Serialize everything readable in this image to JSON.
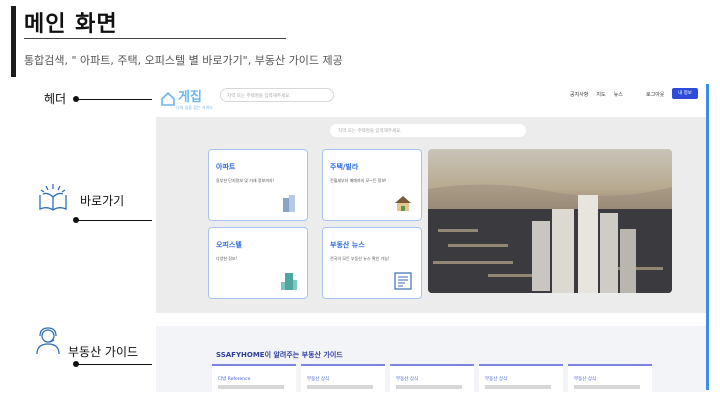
{
  "slide": {
    "title": "메인 화면",
    "subtitle": "통합검색,  \" 아파트, 주택, 오피스텔 별 바로가기\", 부동산 가이드 제공"
  },
  "annotations": {
    "header": "헤더",
    "shortcut": "바로가기",
    "guide": "부동산 가이드"
  },
  "mock": {
    "logo": "게집",
    "logo_sub": "나의 집을 찾는 가이드",
    "nav_search_placeholder": "지역 또는 주택명을 입력해주세요.",
    "nav_links": [
      "공지사항",
      "지도",
      "뉴스"
    ],
    "login": "로그아웃",
    "my_info": "내 정보",
    "hero_search_placeholder": "지역 또는 주택명을 입력해주세요.",
    "cards": [
      {
        "title": "아파트",
        "desc": "용부한 단지정보 및 거래 정보까지!"
      },
      {
        "title": "주택/빌라",
        "desc": "전월세부터 매매까지 모~든 정보!"
      },
      {
        "title": "오피스텔",
        "desc": "다양한 정보!"
      },
      {
        "title": "부동산 뉴스",
        "desc": "전국의 모든 부동산 뉴스 확인 가능!"
      }
    ],
    "guide_title": "SSAFYHOME이 알려주는 부동산 가이드",
    "guide_cards": [
      "다방 Reference",
      "부동산 상식",
      "부동산 상식",
      "부동산 상식",
      "부동산 상식"
    ]
  }
}
